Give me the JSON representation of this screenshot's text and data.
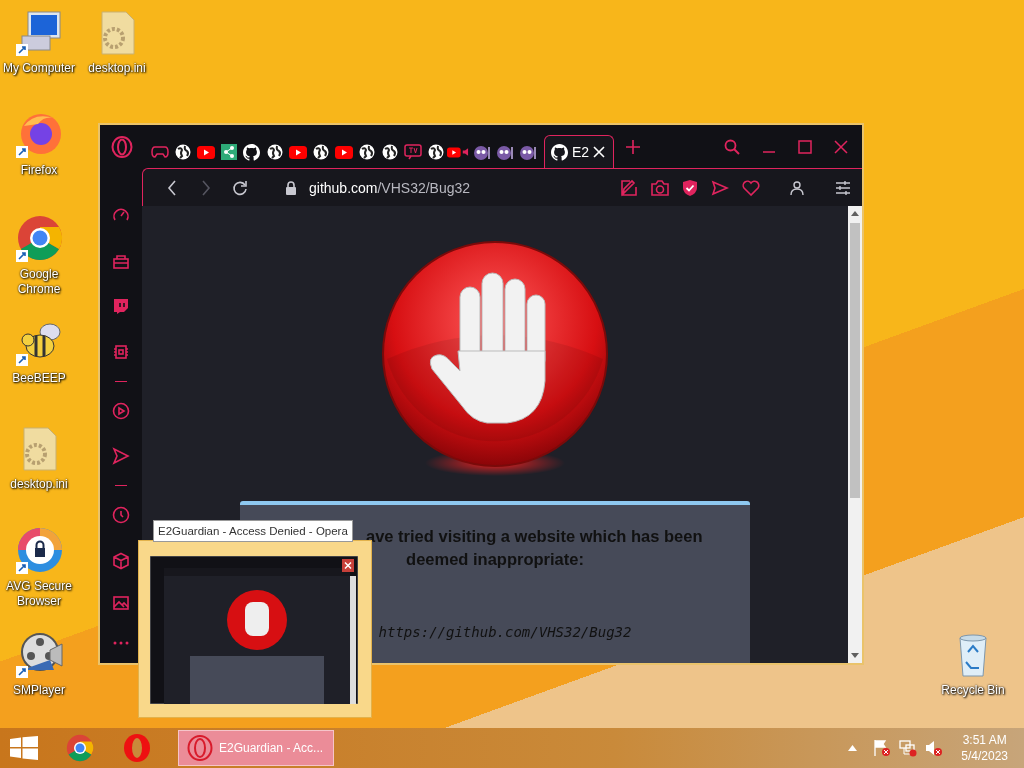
{
  "desktop_icons": [
    {
      "label": "My Computer",
      "kind": "computer"
    },
    {
      "label": "desktop.ini",
      "kind": "file"
    },
    {
      "label": "Firefox",
      "kind": "firefox"
    },
    {
      "label": "Google Chrome",
      "kind": "chrome"
    },
    {
      "label": "BeeBEEP",
      "kind": "bee"
    },
    {
      "label": "desktop.ini",
      "kind": "file"
    },
    {
      "label": "AVG Secure Browser",
      "kind": "avg"
    },
    {
      "label": "SMPlayer",
      "kind": "player"
    },
    {
      "label": "Recycle Bin",
      "kind": "bin"
    }
  ],
  "tabs": [
    {
      "kind": "gamepad",
      "selected": false,
      "audio": false
    },
    {
      "kind": "globe",
      "selected": false,
      "audio": false
    },
    {
      "kind": "youtube",
      "selected": false,
      "audio": false
    },
    {
      "kind": "share",
      "selected": false,
      "audio": false
    },
    {
      "kind": "github",
      "selected": false,
      "audio": false
    },
    {
      "kind": "globe",
      "selected": false,
      "audio": false
    },
    {
      "kind": "youtube",
      "selected": false,
      "audio": false
    },
    {
      "kind": "globe",
      "selected": false,
      "audio": false
    },
    {
      "kind": "youtube",
      "selected": false,
      "audio": false
    },
    {
      "kind": "globe",
      "selected": false,
      "audio": false
    },
    {
      "kind": "globe",
      "selected": false,
      "audio": false
    },
    {
      "kind": "tv",
      "selected": false,
      "audio": false
    },
    {
      "kind": "globe",
      "selected": false,
      "audio": false
    },
    {
      "kind": "youtube",
      "selected": false,
      "audio": true
    },
    {
      "kind": "avatar",
      "selected": false,
      "audio": false
    },
    {
      "kind": "avatar",
      "selected": false,
      "audio": false
    },
    {
      "kind": "avatar",
      "selected": false,
      "audio": false
    },
    {
      "kind": "github",
      "selected": true,
      "audio": false,
      "label": "E2"
    }
  ],
  "address_bar": {
    "host": "github.com",
    "path": "/VHS32/Bug32"
  },
  "page": {
    "message_lines": [
      "ave tried visiting a website which has been",
      "deemed inappropriate:"
    ],
    "blocked_url": "https://github.com/VHS32/Bug32"
  },
  "tooltip": "E2Guardian - Access Denied - Opera",
  "taskbar": {
    "window_button": {
      "label": "E2Guardian - Acc...",
      "selected": true
    },
    "time": "3:51 AM",
    "date": "5/4/2023"
  }
}
